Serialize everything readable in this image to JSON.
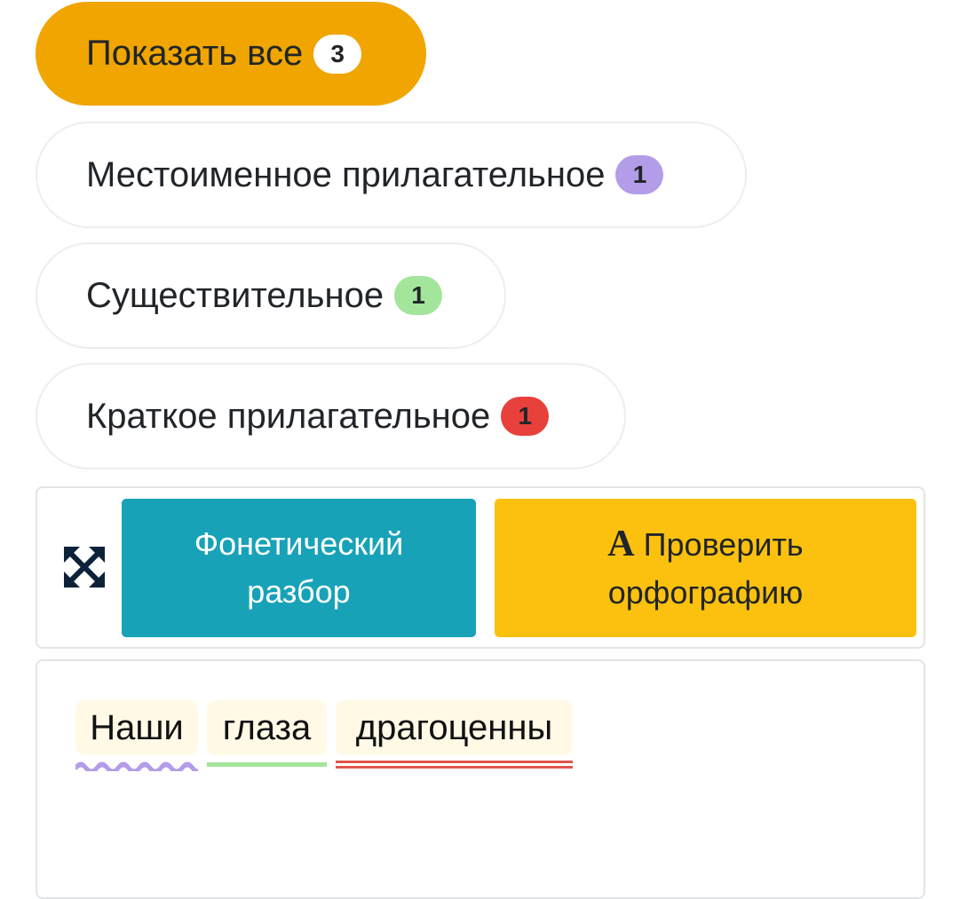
{
  "filters": [
    {
      "label": "Показать все",
      "count": "3",
      "active": true,
      "badge_color": "#ffffff"
    },
    {
      "label": "Местоименное прилагательное",
      "count": "1",
      "active": false,
      "badge_color": "#b39ce8"
    },
    {
      "label": "Существительное",
      "count": "1",
      "active": false,
      "badge_color": "#a3e59a"
    },
    {
      "label": "Краткое прилагательное",
      "count": "1",
      "active": false,
      "badge_color": "#e8403a"
    }
  ],
  "toolbar": {
    "expand_icon": "expand-arrows-icon",
    "phonetic_label": "Фонетический разбор",
    "spell_icon_glyph": "A",
    "spell_label": "Проверить орфографию"
  },
  "sentence": {
    "words": [
      {
        "text": "Наши",
        "underline": "wavy",
        "color": "#b39ce8"
      },
      {
        "text": "глаза",
        "underline": "single",
        "color": "#a3e59a"
      },
      {
        "text": "драгоценны",
        "underline": "double",
        "color": "#e0554f"
      }
    ]
  },
  "colors": {
    "active_filter": "#f0a500",
    "phonetic_button": "#17a2b8",
    "spell_button": "#fcc10f"
  }
}
